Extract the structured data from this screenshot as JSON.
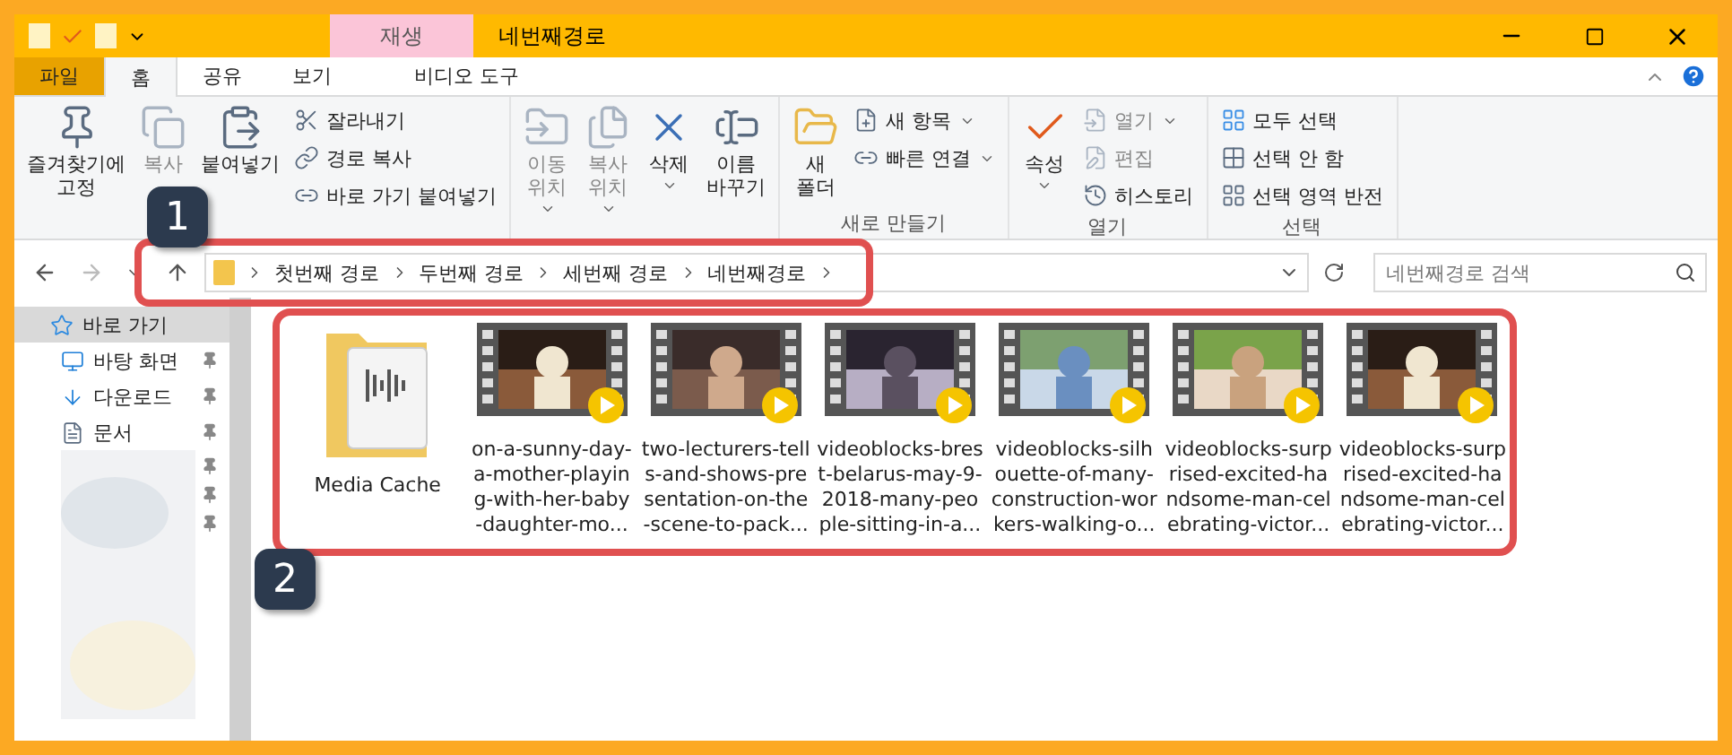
{
  "window": {
    "title": "네번째경로",
    "context_tab": "재생"
  },
  "tabs": [
    {
      "label": "파일",
      "kind": "file",
      "selected": false
    },
    {
      "label": "홈",
      "kind": "tab",
      "selected": true
    },
    {
      "label": "공유",
      "kind": "tab",
      "selected": false
    },
    {
      "label": "보기",
      "kind": "tab",
      "selected": false
    },
    {
      "label": "비디오 도구",
      "kind": "tab",
      "selected": false
    }
  ],
  "ribbon": {
    "groups": [
      {
        "large": [
          {
            "label": "즐겨찾기에 고정",
            "disabled": false
          },
          {
            "label": "복사",
            "disabled": true
          },
          {
            "label": "붙여넣기",
            "disabled": false
          }
        ],
        "small": [
          {
            "label": "잘라내기",
            "disabled": false
          },
          {
            "label": "경로 복사",
            "disabled": false
          },
          {
            "label": "바로 가기 붙여넣기",
            "disabled": false
          }
        ]
      },
      {
        "large": [
          {
            "label": "이동 위치",
            "disabled": true,
            "dropdown": true
          },
          {
            "label": "복사 위치",
            "disabled": true,
            "dropdown": true
          },
          {
            "label": "삭제",
            "disabled": false,
            "dropdown": true
          },
          {
            "label": "이름 바꾸기",
            "disabled": false
          }
        ]
      },
      {
        "label": "새로 만들기",
        "large": [
          {
            "label": "새 폴더",
            "disabled": false
          }
        ],
        "small": [
          {
            "label": "새 항목",
            "disabled": false,
            "dropdown": true
          },
          {
            "label": "빠른 연결",
            "disabled": false,
            "dropdown": true
          }
        ]
      },
      {
        "label": "열기",
        "large": [
          {
            "label": "속성",
            "disabled": false,
            "dropdown": true
          }
        ],
        "small": [
          {
            "label": "열기",
            "disabled": true,
            "dropdown": true
          },
          {
            "label": "편집",
            "disabled": true
          },
          {
            "label": "히스토리",
            "disabled": false
          }
        ]
      },
      {
        "label": "선택",
        "small": [
          {
            "label": "모두 선택",
            "disabled": false
          },
          {
            "label": "선택 안 함",
            "disabled": false
          },
          {
            "label": "선택 영역 반전",
            "disabled": false
          }
        ]
      }
    ]
  },
  "address": {
    "crumbs": [
      "첫번째 경로",
      "두번째 경로",
      "세번째 경로",
      "네번째경로"
    ],
    "search_placeholder": "네번째경로 검색"
  },
  "sidebar": {
    "items": [
      {
        "label": "바로 가기",
        "selected": true,
        "pinned": false
      },
      {
        "label": "바탕 화면",
        "selected": false,
        "pinned": true
      },
      {
        "label": "다운로드",
        "selected": false,
        "pinned": true
      },
      {
        "label": "문서",
        "selected": false,
        "pinned": true
      }
    ]
  },
  "files": [
    {
      "kind": "folder",
      "lines": [
        "Media Cache"
      ]
    },
    {
      "kind": "video",
      "lines": [
        "on-a-sunny-day-",
        "a-mother-playin",
        "g-with-her-baby",
        "-daughter-mo..."
      ]
    },
    {
      "kind": "video",
      "lines": [
        "two-lecturers-tell",
        "s-and-shows-pre",
        "sentation-on-the",
        "-scene-to-pack..."
      ]
    },
    {
      "kind": "video",
      "lines": [
        "videoblocks-bres",
        "t-belarus-may-9-",
        "2018-many-peo",
        "ple-sitting-in-a..."
      ]
    },
    {
      "kind": "video",
      "lines": [
        "videoblocks-silh",
        "ouette-of-many-",
        "construction-wor",
        "kers-walking-o..."
      ]
    },
    {
      "kind": "video",
      "lines": [
        "videoblocks-surp",
        "rised-excited-ha",
        "ndsome-man-cel",
        "ebrating-victor..."
      ]
    },
    {
      "kind": "video",
      "lines": [
        "videoblocks-surp",
        "rised-excited-ha",
        "ndsome-man-cel",
        "ebrating-victor..."
      ]
    }
  ],
  "annotations": [
    {
      "label": "1",
      "kind": "address"
    },
    {
      "label": "2",
      "kind": "files"
    }
  ]
}
